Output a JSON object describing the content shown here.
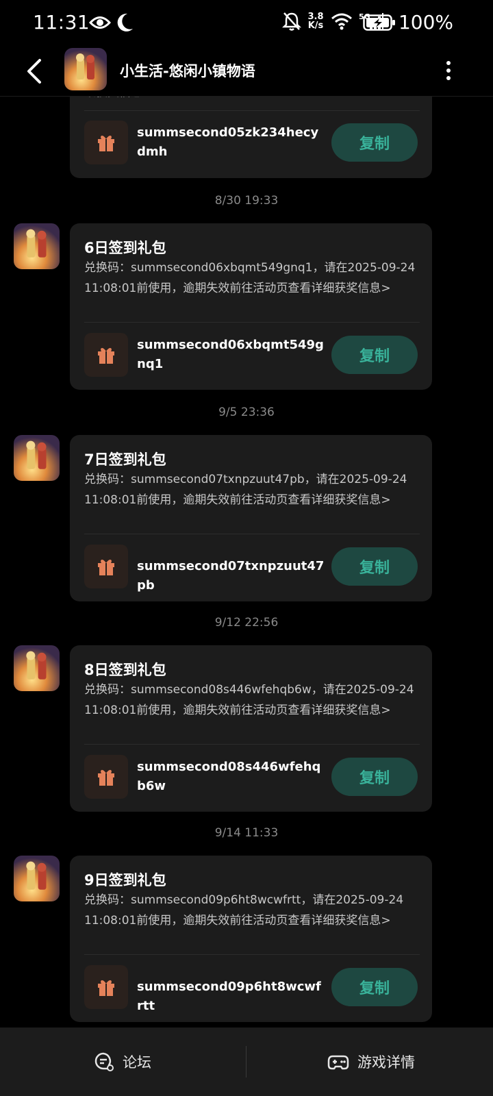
{
  "status_bar": {
    "time": "11:31",
    "speed_value": "3.8",
    "speed_unit": "K/s",
    "battery": "100%"
  },
  "header": {
    "title": "小生活-悠闲小镇物语"
  },
  "partial_card": {
    "body_tail": "细获奖信息>",
    "code": "summsecond05zk234hecydmh",
    "copy_label": "复制"
  },
  "messages": [
    {
      "time": "8/30  19:33",
      "title": "6日签到礼包",
      "body": "兑换码：summsecond06xbqmt549gnq1，请在2025-09-24 11:08:01前使用，逾期失效前往活动页查看详细获奖信息>",
      "code": "summsecond06xbqmt549gnq1",
      "copy_label": "复制"
    },
    {
      "time": "9/5  23:36",
      "title": "7日签到礼包",
      "body": "兑换码：summsecond07txnpzuut47pb，请在2025-09-24 11:08:01前使用，逾期失效前往活动页查看详细获奖信息>",
      "code": "summsecond07txnpzuut47pb",
      "copy_label": "复制"
    },
    {
      "time": "9/12  22:56",
      "title": "8日签到礼包",
      "body": "兑换码：summsecond08s446wfehqb6w，请在2025-09-24 11:08:01前使用，逾期失效前往活动页查看详细获奖信息>",
      "code": "summsecond08s446wfehqb6w",
      "copy_label": "复制"
    },
    {
      "time": "9/14  11:33",
      "title": "9日签到礼包",
      "body": "兑换码：summsecond09p6ht8wcwfrtt，请在2025-09-24 11:08:01前使用，逾期失效前往活动页查看详细获奖信息>",
      "code": "summsecond09p6ht8wcwfrtt",
      "copy_label": "复制"
    }
  ],
  "bottom_bar": {
    "forum_label": "论坛",
    "game_details_label": "游戏详情"
  },
  "colors": {
    "accent": "#39b29a",
    "button_bg": "#1e4841",
    "gift_icon": "#e5825a",
    "card_bg": "#1c1c1c"
  }
}
